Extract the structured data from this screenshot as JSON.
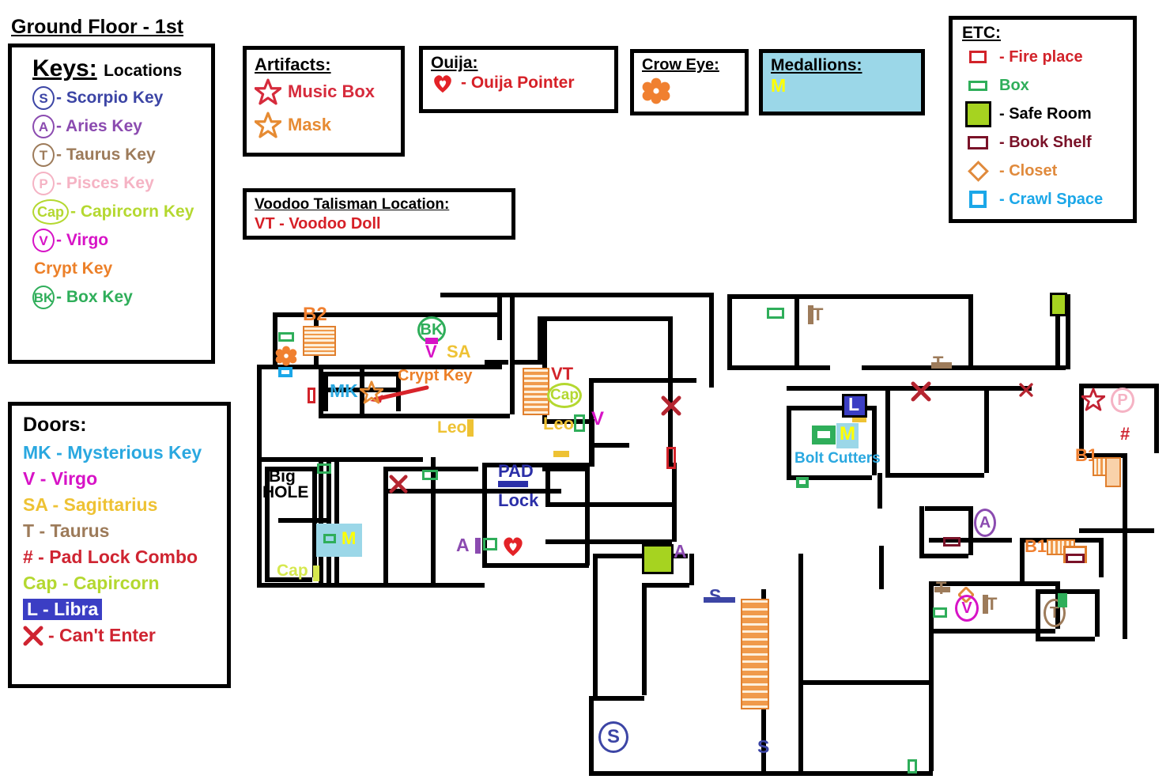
{
  "page": {
    "floor_title": "Ground Floor - 1st"
  },
  "keys_legend": {
    "heading_main": "Keys:",
    "heading_sub": "Locations",
    "items": [
      {
        "badge": "S",
        "label": "- Scorpio Key",
        "color": "#3c45a5",
        "shape": "circle"
      },
      {
        "badge": "A",
        "label": "- Aries Key",
        "color": "#8b4bb0",
        "shape": "circle"
      },
      {
        "badge": "T",
        "label": "- Taurus Key",
        "color": "#9d7b5a",
        "shape": "circle"
      },
      {
        "badge": "P",
        "label": "- Pisces Key",
        "color": "#f5b3c4",
        "shape": "circle"
      },
      {
        "badge": "Cap",
        "label": "- Capircorn Key",
        "color": "#b4d830",
        "shape": "ellipse"
      },
      {
        "badge": "V",
        "label": "- Virgo",
        "color": "#d713c6",
        "shape": "circle"
      },
      {
        "badge": "",
        "label": "Crypt Key",
        "color": "#ec8029",
        "shape": "none"
      },
      {
        "badge": "BK",
        "label": "- Box Key",
        "color": "#2fae5a",
        "shape": "circle"
      }
    ]
  },
  "doors_legend": {
    "heading": "Doors:",
    "items": [
      {
        "text": "MK - Mysterious Key",
        "color": "#2aa8e0",
        "highlight": false
      },
      {
        "text": "V - Virgo",
        "color": "#d713c6",
        "highlight": false
      },
      {
        "text": "SA - Sagittarius",
        "color": "#eec234",
        "highlight": false
      },
      {
        "text": "T - Taurus",
        "color": "#9d7b5a",
        "highlight": false
      },
      {
        "text": "# - Pad Lock Combo",
        "color": "#cf2431",
        "highlight": false
      },
      {
        "text": "Cap - Capircorn",
        "color": "#b4d830",
        "highlight": false
      },
      {
        "text": "L - Libra",
        "color": "#ffffff",
        "highlight": true
      },
      {
        "text": "- Can't Enter",
        "color": "#cf2431",
        "highlight": false,
        "icon": "red-x-icon"
      }
    ]
  },
  "artifacts_legend": {
    "title": "Artifacts:",
    "items": [
      {
        "label": "Music Box",
        "color": "#d62b3c",
        "icon": "star-icon"
      },
      {
        "label": "Mask",
        "color": "#e68b33",
        "icon": "star-icon"
      }
    ]
  },
  "voodoo_legend": {
    "title": "Voodoo Talisman Location:",
    "line": "VT - Voodoo Doll"
  },
  "ouija_legend": {
    "title": "Ouija:",
    "label": "- Ouija Pointer",
    "icon": "heart-icon",
    "color": "#e32227"
  },
  "crow_legend": {
    "title": "Crow Eye:",
    "icon": "crow-eye-flower-icon",
    "color": "#f08030"
  },
  "medallion_legend": {
    "title": "Medallions:",
    "letter": "M",
    "bg": "#9bd7e8",
    "letter_color": "#ffff00"
  },
  "etc_legend": {
    "title": "ETC:",
    "items": [
      {
        "label": "- Fire place",
        "color": "#d2232a",
        "icon": "fireplace-icon"
      },
      {
        "label": "Box",
        "color": "#2fae5a",
        "icon": "box-icon"
      },
      {
        "label": "- Safe Room",
        "color": "#000000",
        "icon": "safe-room-icon"
      },
      {
        "label": "- Book Shelf",
        "color": "#7a1228",
        "icon": "bookshelf-icon"
      },
      {
        "label": "- Closet",
        "color": "#e08a3c",
        "icon": "closet-icon"
      },
      {
        "label": "- Crawl Space",
        "color": "#1ba7e8",
        "icon": "crawl-space-icon"
      }
    ]
  },
  "map_labels": {
    "b2": "B2",
    "bk": "BK",
    "v_door_top": "V",
    "sa_door": "SA",
    "crypt_key": "Crypt Key",
    "mk_door": "MK",
    "leo_left": "Leo",
    "leo_mid": "Leo",
    "vt": "VT",
    "cap_mid": "Cap",
    "v_door_mid": "V",
    "big_hole_1": "Big",
    "big_hole_2": "HOLE",
    "cap_bottom": "Cap",
    "medallion_left": "M",
    "pad": "PAD",
    "lock": "Lock",
    "a_left": "A",
    "a_safe": "A",
    "t_top": "T",
    "t_mid": "T",
    "libra": "L",
    "medallion_bolt": "M",
    "bolt_cutters": "Bolt Cutters",
    "aries_right": "A",
    "pisces_right": "P",
    "hash": "#",
    "b1_upper": "B1",
    "b1_lower": "B1",
    "t_br_1": "T",
    "t_br_2": "T",
    "virgo_br": "V",
    "taurus_br": "T",
    "s_stair_top": "S",
    "s_stair_bottom": "S",
    "s_circle": "S"
  }
}
